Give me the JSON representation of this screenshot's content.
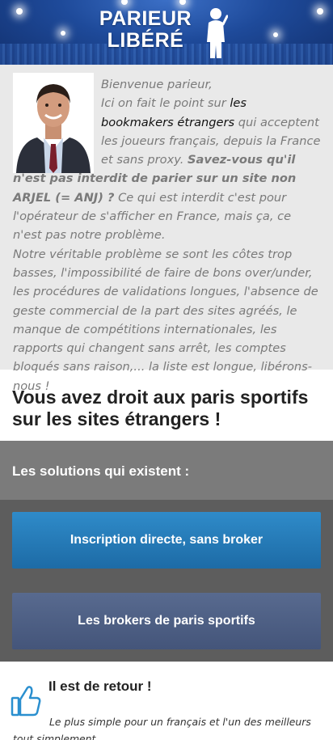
{
  "header": {
    "logo_line1": "PARIEUR",
    "logo_line2": "LIBÉRÉ",
    "logo_alt": "parieur-libere-logo"
  },
  "intro": {
    "greeting": "Bienvenue parieur,",
    "p1_before_link": "Ici on fait le point sur ",
    "p1_link": "les bookmakers étrangers",
    "p1_after_link": " qui acceptent les joueurs français, depuis la France et sans proxy. ",
    "p1_bold": "Savez-vous qu'il n'est pas interdit de parier sur un site non ARJEL (= ANJ) ?",
    "p1_end": " Ce qui est interdit c'est pour l'opérateur de s'afficher en France, mais ça, ce n'est pas notre problème.",
    "p2": "Notre véritable problème se sont les côtes trop basses, l'impossibilité de faire de bons over/under, les procédures de validations longues, l'absence de geste commercial de la part des sites agréés, le manque de compétitions internationales, les rapports qui changent sans arrêt, les comptes bloqués sans raison,... la liste est longue, libérons-nous !"
  },
  "headline": "Vous avez droit aux paris sportifs sur les sites étrangers !",
  "solutions": {
    "title": "Les solutions qui existent :",
    "button_direct": "Inscription directe, sans broker",
    "button_brokers": "Les brokers de paris sportifs"
  },
  "promo": {
    "title": "Il est de retour !",
    "text": "Le plus simple pour un français et l'un des meilleurs tout simplement"
  },
  "colors": {
    "link": "#111111",
    "button_direct": "#2a7fbf",
    "button_brokers": "#4e6086",
    "thumb": "#2a8fcf"
  }
}
